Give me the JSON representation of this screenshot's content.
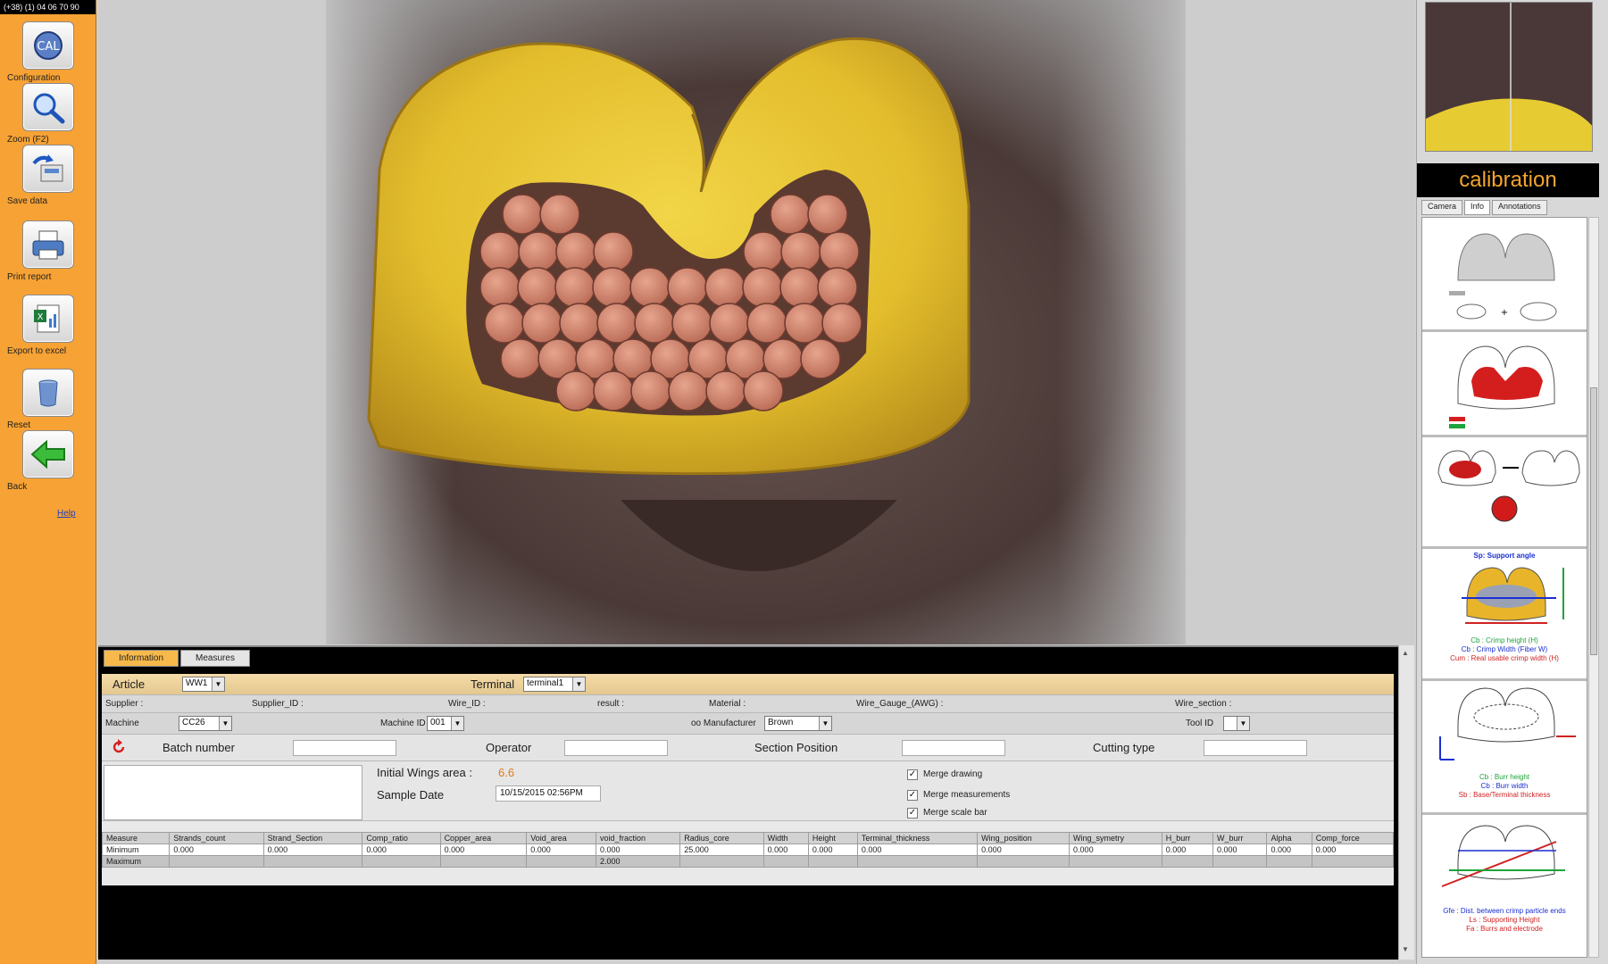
{
  "window": {
    "clock_text": "(+38) (1) 04 06 70 90"
  },
  "toolbar": {
    "items": [
      {
        "label": "Configuration",
        "icon": "calibration-icon"
      },
      {
        "label": "Zoom (F2)",
        "icon": "magnifier-icon"
      },
      {
        "label": "Save data",
        "icon": "save-icon"
      },
      {
        "label": "Print report",
        "icon": "printer-icon"
      },
      {
        "label": "Export to excel",
        "icon": "excel-icon"
      },
      {
        "label": "Reset",
        "icon": "reset-icon"
      },
      {
        "label": "Back",
        "icon": "back-arrow-icon"
      }
    ],
    "help_label": "Help"
  },
  "right_panel": {
    "title": "calibration",
    "tabs": [
      "Camera",
      "Info",
      "Annotations"
    ],
    "active_tab": "Info",
    "guide": {
      "item1_caption": "Sp: Support angle",
      "item2_captions": [
        "Cb : Crimp height (H)",
        "Cb : Crimp Width (Fiber W)",
        "Cum : Real usable crimp width (H)"
      ],
      "item3_captions": [
        "Cb : Burr height",
        "Cb : Burr width",
        "Sb : Base/Terminal thickness"
      ],
      "item4_captions": [
        "Gfe : Dist. between crimp particle ends",
        "Ls : Supporting Height",
        "Fa : Burrs and electrode"
      ]
    }
  },
  "info_panel": {
    "tabs": [
      "Information",
      "Measures"
    ],
    "active_tab": "Information",
    "article": {
      "label": "Article",
      "value": "WW1"
    },
    "terminal": {
      "label": "Terminal",
      "value": "terminal1"
    },
    "row2_labels": [
      "Supplier :",
      "Supplier_ID :",
      "Wire_ID :",
      "result :",
      "Material :",
      "Wire_Gauge_(AWG) :",
      "Wire_section :"
    ],
    "machine": {
      "label": "Machine",
      "value": "CC26"
    },
    "machine_id": {
      "label": "Machine ID",
      "value": "001"
    },
    "manufacturer": {
      "label": "oo Manufacturer",
      "value": "Brown"
    },
    "tool_id": {
      "label": "Tool ID",
      "value": ""
    },
    "batch_number": {
      "label": "Batch number",
      "value": ""
    },
    "operator": {
      "label": "Operator",
      "value": ""
    },
    "section_position": {
      "label": "Section Position",
      "value": ""
    },
    "cutting_type": {
      "label": "Cutting type",
      "value": ""
    },
    "initial_wings_area": {
      "label": "Initial Wings area :",
      "value": "6.6"
    },
    "sample_date": {
      "label": "Sample Date",
      "value": "10/15/2015 02:56PM"
    },
    "checkboxes": [
      {
        "label": "Merge drawing",
        "checked": true
      },
      {
        "label": "Merge measurements",
        "checked": true
      },
      {
        "label": "Merge scale bar",
        "checked": true
      }
    ],
    "colors": {
      "tab_active": "#f7b94b",
      "accent_value": "#e07a1a"
    }
  },
  "measures_table": {
    "headers": [
      "Measure",
      "Strands_count",
      "Strand_Section",
      "Comp_ratio",
      "Copper_area",
      "Void_area",
      "void_fraction",
      "Radius_core",
      "Width",
      "Height",
      "Terminal_thickness",
      "Wing_position",
      "Wing_symetry",
      "H_burr",
      "W_burr",
      "Alpha",
      "Comp_force"
    ],
    "minimum": [
      "Minimum",
      "0.000",
      "0.000",
      "0.000",
      "0.000",
      "0.000",
      "0.000",
      "25.000",
      "0.000",
      "0.000",
      "0.000",
      "0.000",
      "0.000",
      "0.000",
      "0.000",
      "0.000",
      "0.000"
    ],
    "maximum": [
      "Maximum",
      "",
      "",
      "",
      "",
      "",
      "2.000",
      "",
      "",
      "",
      "",
      "",
      "",
      "",
      "",
      "",
      ""
    ]
  }
}
